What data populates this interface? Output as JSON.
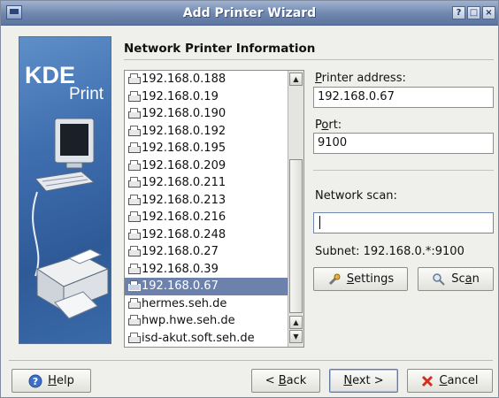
{
  "window": {
    "title": "Add Printer Wizard"
  },
  "titlebar_buttons": {
    "help": "?",
    "maximize": "□",
    "close": "×"
  },
  "banner": {
    "line1": "KDE",
    "line2": "Print"
  },
  "page": {
    "title": "Network Printer Information"
  },
  "printer_list": {
    "items": [
      "192.168.0.188",
      "192.168.0.19",
      "192.168.0.190",
      "192.168.0.192",
      "192.168.0.195",
      "192.168.0.209",
      "192.168.0.211",
      "192.168.0.213",
      "192.168.0.216",
      "192.168.0.248",
      "192.168.0.27",
      "192.168.0.39",
      "192.168.0.67",
      "hermes.seh.de",
      "hwp.hwe.seh.de",
      "isd-akut.soft.seh.de"
    ],
    "selected_index": 12
  },
  "form": {
    "address_label_u": "P",
    "address_label_rest": "rinter address:",
    "address_value": "192.168.0.67",
    "port_label_u": "P",
    "port_label_mid": "o",
    "port_label_rest": "rt:",
    "port_value": "9100",
    "scan_label": "Network scan:",
    "subnet": "Subnet: 192.168.0.*:9100"
  },
  "buttons": {
    "settings_u": "S",
    "settings_rest": "ettings",
    "scan_pre": "Sc",
    "scan_u": "a",
    "scan_rest": "n",
    "help_u": "H",
    "help_rest": "elp",
    "back_pre": "< ",
    "back_u": "B",
    "back_rest": "ack",
    "next_u": "N",
    "next_rest": "ext >",
    "cancel_u": "C",
    "cancel_rest": "ancel"
  },
  "colors": {
    "selection": "#6c82ad",
    "titlebar": "#6f86ad",
    "banner": "#3f6eaf"
  }
}
